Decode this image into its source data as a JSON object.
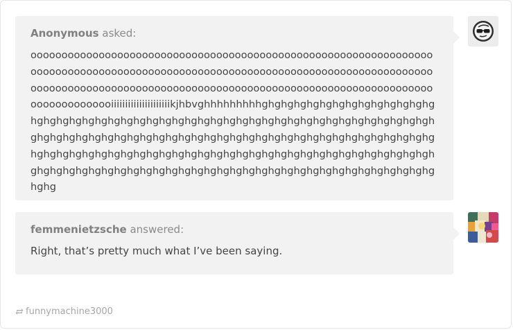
{
  "question": {
    "asker": "Anonymous",
    "asked_label": "asked:",
    "text": "ooooooooooooooooooooooooooooooooooooooooooooooooooooooooooooooooooooooooooooooooooooooooooooooooooooooooooooooooooooooooooooooooooooooooooooooooooooooooooooooooooooooooooooooooooooooooooooooooooooooooooooooooiiiiiiiiiiiiiiiiiiiiikjhbvghhhhhhhhhghghghghghghghghghghghghghghghghghghghghghghghghghghghghghghghghghghghghghghghghghghghghghghghghghghghghghghghghghghghghghghghghghghghghghghghghghghghghghghghghghghghghghghghghghghghghghghghghghghghghghghghghghghghghghghghghghghghghghghghghghghghghghghghghghghghghghghghghghghghghghg"
  },
  "answer": {
    "answerer": "femmenietzsche",
    "answered_label": "answered:",
    "text": "Right, that’s pretty much what I’ve been saying."
  },
  "footer": {
    "source_icon": "reblog-icon",
    "source_name": "funnymachine3000"
  },
  "avatars": {
    "asker_icon": "anonymous-sunglasses-icon",
    "answerer_icon": "colorful-avatar-image"
  }
}
